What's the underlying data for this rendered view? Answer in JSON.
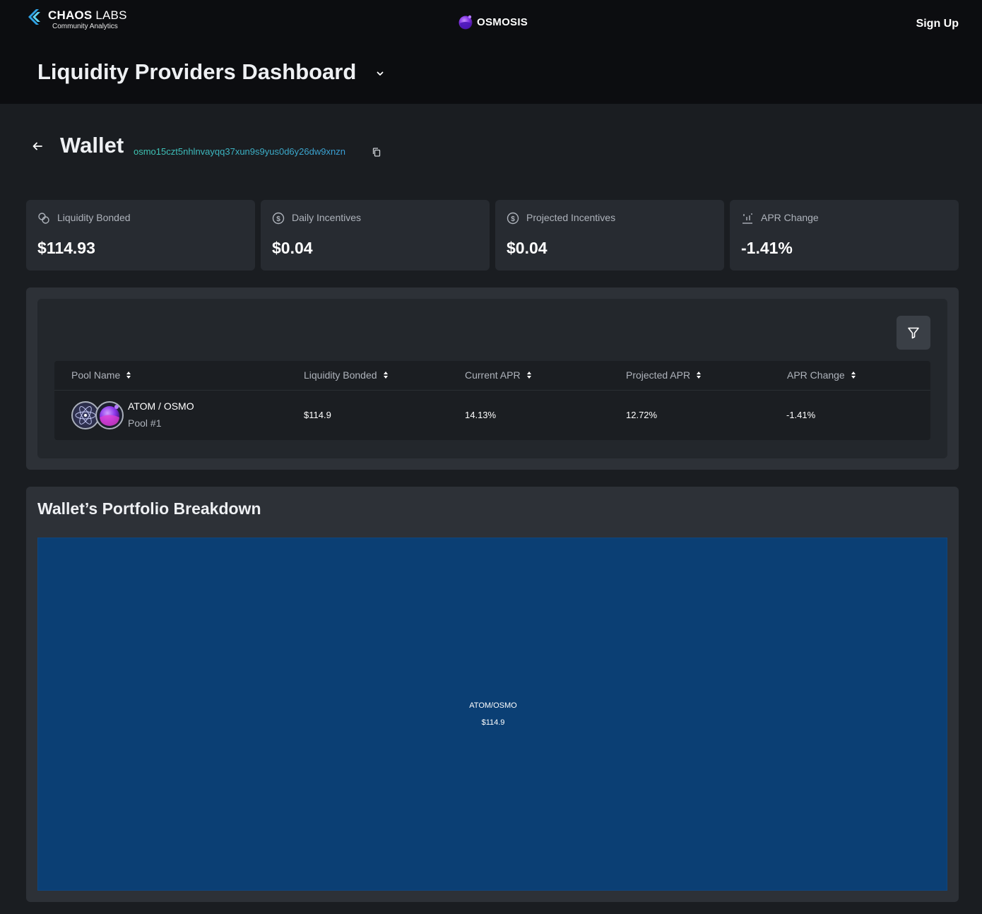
{
  "header": {
    "brand_name_bold": "CHAOS",
    "brand_name_light": "LABS",
    "brand_sub": "Community Analytics",
    "network": "OSMOSIS",
    "signup": "Sign Up",
    "page_title": "Liquidity Providers Dashboard"
  },
  "wallet": {
    "title": "Wallet",
    "address": "osmo15czt5nhlnvayqq37xun9s9yus0d6y26dw9xnzn"
  },
  "stats": [
    {
      "label": "Liquidity Bonded",
      "value": "$114.93",
      "icon": "coins-icon"
    },
    {
      "label": "Daily Incentives",
      "value": "$0.04",
      "icon": "dollar-circle-icon"
    },
    {
      "label": "Projected Incentives",
      "value": "$0.04",
      "icon": "dollar-circle-icon"
    },
    {
      "label": "APR Change",
      "value": "-1.41%",
      "icon": "bar-chart-icon"
    }
  ],
  "table": {
    "columns": [
      "Pool Name",
      "Liquidity Bonded",
      "Current APR",
      "Projected APR",
      "APR Change"
    ],
    "rows": [
      {
        "pool_name": "ATOM / OSMO",
        "pool_id": "Pool #1",
        "liquidity_bonded": "$114.9",
        "current_apr": "14.13%",
        "projected_apr": "12.72%",
        "apr_change": "-1.41%"
      }
    ]
  },
  "portfolio": {
    "title": "Wallet’s Portfolio Breakdown",
    "items": [
      {
        "name": "ATOM/OSMO",
        "value": "$114.9",
        "color": "#0b3f74"
      }
    ]
  },
  "colors": {
    "accent_teal": "#3fc9b5",
    "accent_blue": "#3aa0d8",
    "treemap_fill": "#0b3f74"
  }
}
